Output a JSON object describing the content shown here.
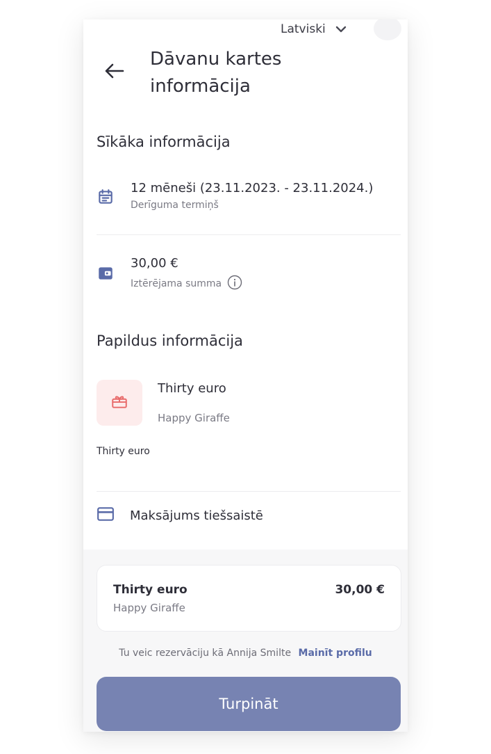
{
  "header": {
    "language": "Latviski",
    "title": "Dāvanu kartes informācija"
  },
  "details": {
    "section_title": "Sīkāka informācija",
    "validity": {
      "value": "12 mēneši (23.11.2023. - 23.11.2024.)",
      "label": "Derīguma termiņš"
    },
    "amount": {
      "value": "30,00 €",
      "label": "Iztērējama summa"
    }
  },
  "additional": {
    "section_title": "Papildus informācija",
    "gift_name": "Thirty euro",
    "gift_vendor": "Happy Giraffe",
    "description": "Thirty euro"
  },
  "payment": {
    "label": "Maksājums tiešsaistē"
  },
  "summary": {
    "name": "Thirty euro",
    "vendor": "Happy Giraffe",
    "price": "30,00 €"
  },
  "booking": {
    "text": "Tu veic rezervāciju kā Annija Smilte",
    "change_profile": "Mainīt profilu"
  },
  "continue_label": "Turpināt",
  "colors": {
    "accent": "#7783b2",
    "icon": "#5a6ba8",
    "gift_icon": "#e86a6a",
    "gift_bg": "#fdecec"
  }
}
